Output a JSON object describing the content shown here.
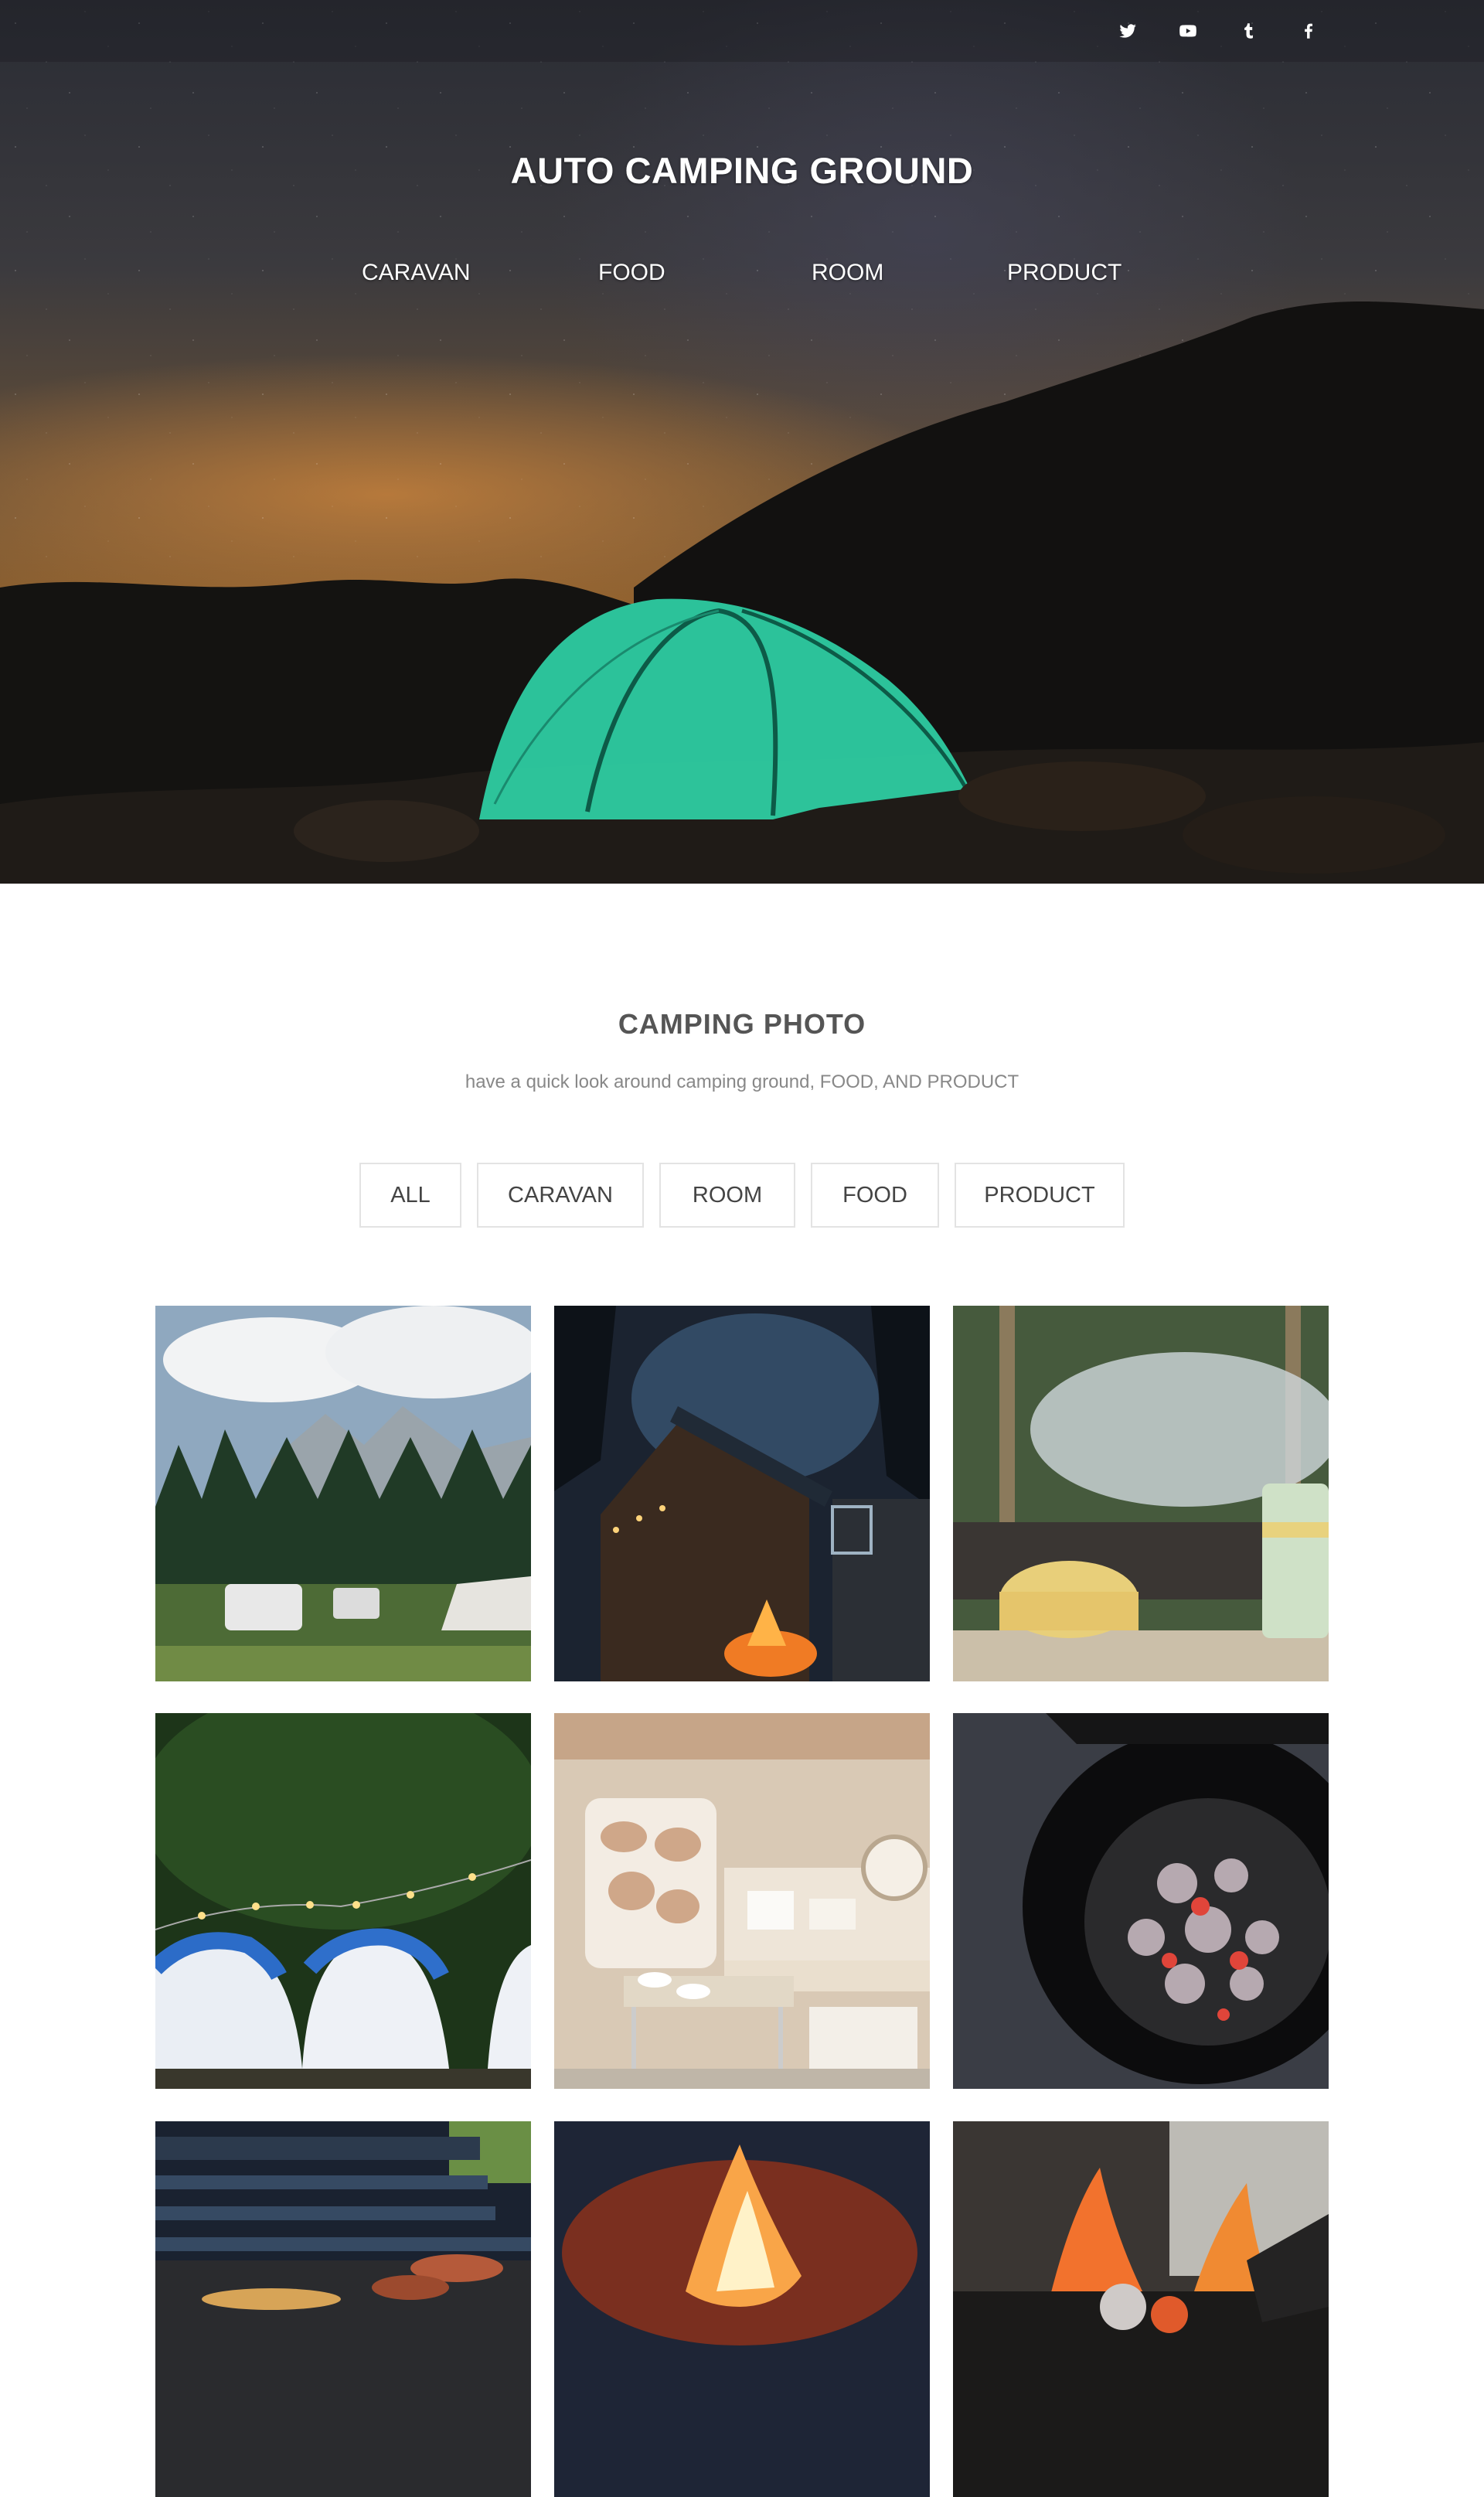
{
  "header": {
    "site_title": "AUTO CAMPING GROUND",
    "social_icons": [
      "twitter-icon",
      "youtube-icon",
      "tumblr-icon",
      "facebook-icon"
    ],
    "nav": [
      {
        "label": "CARAVAN"
      },
      {
        "label": "FOOD"
      },
      {
        "label": "ROOM"
      },
      {
        "label": "PRODUCT"
      }
    ]
  },
  "section": {
    "title": "CAMPING PHOTO",
    "subtitle": "have a quick look around camping ground, FOOD, AND PRODUCT",
    "filters": [
      {
        "label": "ALL"
      },
      {
        "label": "CARAVAN"
      },
      {
        "label": "ROOM"
      },
      {
        "label": "FOOD"
      },
      {
        "label": "PRODUCT"
      }
    ]
  },
  "gallery": {
    "photos": [
      "caravans-in-forest-photo",
      "cabin-with-campfire-photo",
      "pots-on-grill-photo",
      "tents-with-string-lights-photo",
      "caravan-interior-photo",
      "charcoal-grill-photo",
      "barbecue-grill-photo",
      "campfire-photo",
      "fire-pit-photo"
    ]
  },
  "colors": {
    "tent": "#2fd1a6",
    "title_text": "#555555",
    "subtitle_text": "#888888",
    "filter_border": "#e3e3e3"
  }
}
